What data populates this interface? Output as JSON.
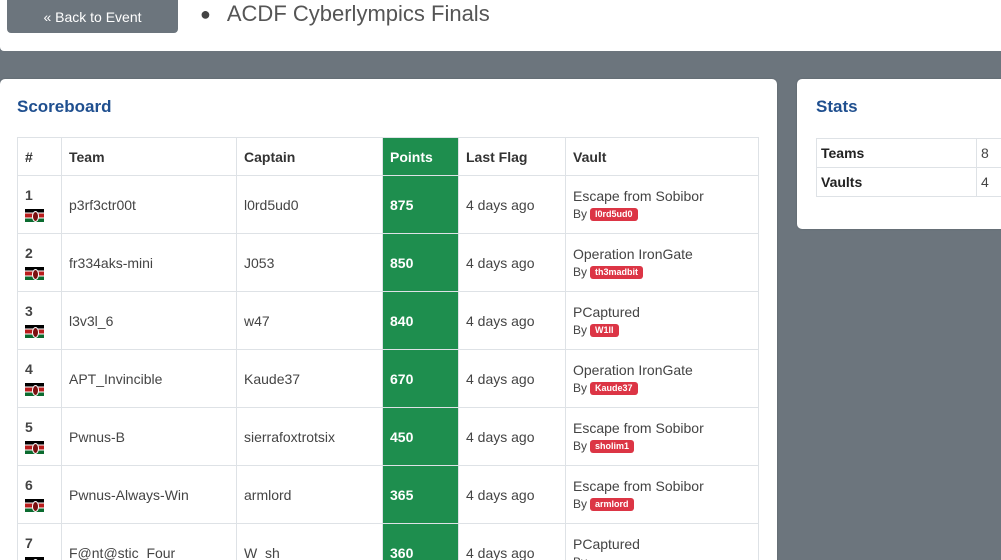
{
  "nav": {
    "back_label": "« Back to Event",
    "event_title": "ACDF Cyberlympics Finals",
    "bullet": "●"
  },
  "scoreboard": {
    "title": "Scoreboard",
    "headers": {
      "rank": "#",
      "team": "Team",
      "captain": "Captain",
      "points": "Points",
      "last_flag": "Last Flag",
      "vault": "Vault"
    },
    "vault_by_label": "By",
    "rows": [
      {
        "rank": "1",
        "team": "p3rf3ctr00t",
        "captain": "l0rd5ud0",
        "points": "875",
        "last_flag": "4 days ago",
        "vault": "Escape from Sobibor",
        "by": "l0rd5ud0"
      },
      {
        "rank": "2",
        "team": "fr334aks-mini",
        "captain": "J053",
        "points": "850",
        "last_flag": "4 days ago",
        "vault": "Operation IronGate",
        "by": "th3madbit"
      },
      {
        "rank": "3",
        "team": "l3v3l_6",
        "captain": "w47",
        "points": "840",
        "last_flag": "4 days ago",
        "vault": "PCaptured",
        "by": "W1ll"
      },
      {
        "rank": "4",
        "team": "APT_Invincible",
        "captain": "Kaude37",
        "points": "670",
        "last_flag": "4 days ago",
        "vault": "Operation IronGate",
        "by": "Kaude37"
      },
      {
        "rank": "5",
        "team": "Pwnus-B",
        "captain": "sierrafoxtrotsix",
        "points": "450",
        "last_flag": "4 days ago",
        "vault": "Escape from Sobibor",
        "by": "sholim1"
      },
      {
        "rank": "6",
        "team": "Pwnus-Always-Win",
        "captain": "armlord",
        "points": "365",
        "last_flag": "4 days ago",
        "vault": "Escape from Sobibor",
        "by": "armlord"
      },
      {
        "rank": "7",
        "team": "F@nt@stic_Four",
        "captain": "W_sh",
        "points": "360",
        "last_flag": "4 days ago",
        "vault": "PCaptured",
        "by": ""
      }
    ]
  },
  "stats": {
    "title": "Stats",
    "rows": [
      {
        "label": "Teams",
        "value": "8"
      },
      {
        "label": "Vaults",
        "value": "4"
      }
    ]
  },
  "colors": {
    "points_bg": "#1e8e4e",
    "badge_bg": "#dc3545",
    "title_color": "#1f4f8f",
    "page_bg": "#6c757d"
  }
}
